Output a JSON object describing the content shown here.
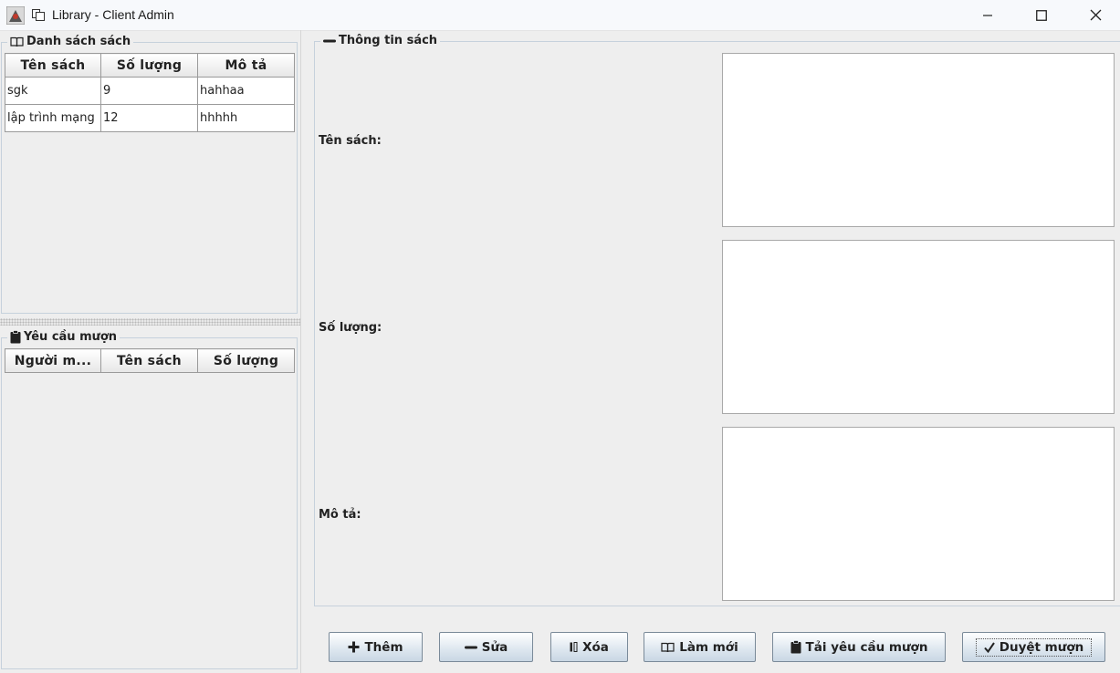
{
  "window": {
    "title": "Library - Client Admin",
    "icons": [
      "app-icon",
      "window-icon",
      "minimize-icon",
      "maximize-icon",
      "close-icon"
    ]
  },
  "books_panel": {
    "title": "Danh sách sách",
    "icon": "book-icon",
    "columns": [
      "Tên sách",
      "Số lượng",
      "Mô tả"
    ],
    "rows": [
      [
        "sgk",
        "9",
        "hahhaa"
      ],
      [
        "lập trình mạng",
        "12",
        "hhhhh"
      ]
    ]
  },
  "requests_panel": {
    "title": "Yêu cầu mượn",
    "icon": "clipboard-icon",
    "columns": [
      "Người m...",
      "Tên sách",
      "Số lượng"
    ],
    "rows": []
  },
  "info_panel": {
    "title": "Thông tin sách",
    "icon": "minus-icon",
    "fields": {
      "name_label": "Tên sách:",
      "name_value": "",
      "quantity_label": "Số lượng:",
      "quantity_value": "",
      "description_label": "Mô tả:",
      "description_value": ""
    }
  },
  "buttons": {
    "add": "Thêm",
    "edit": "Sửa",
    "delete": "Xóa",
    "refresh": "Làm mới",
    "load_requests": "Tải yêu cầu mượn",
    "approve": "Duyệt mượn"
  },
  "colors": {
    "window_bg": "#eeeeee",
    "titlebar_bg": "#f7f9fc",
    "border": "#c6d1dc",
    "button_gradient_bottom": "#c9d7e4"
  }
}
